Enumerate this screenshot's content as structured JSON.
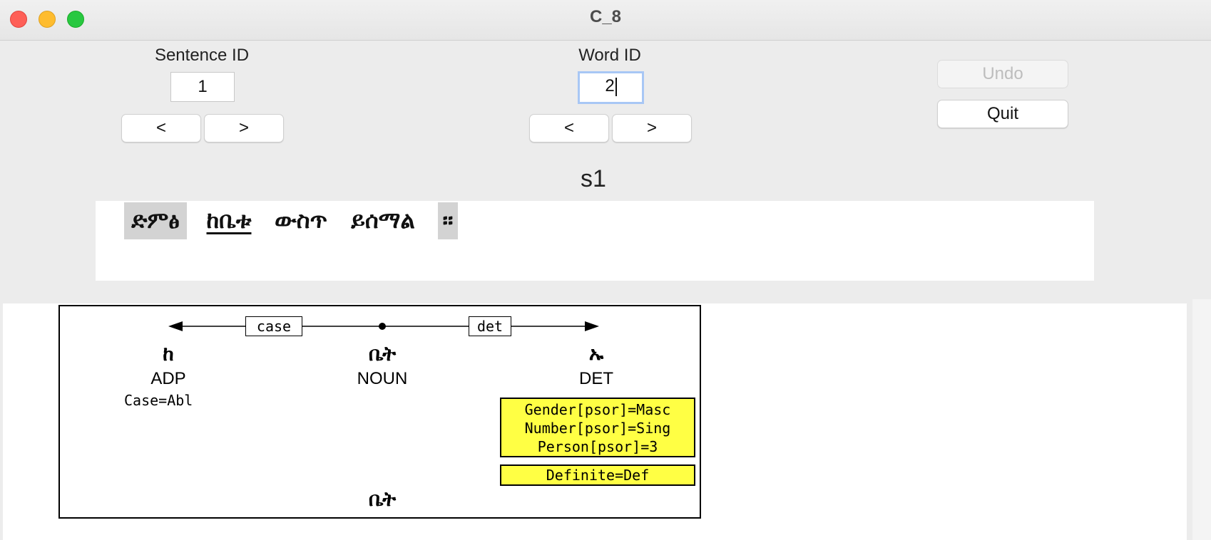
{
  "window": {
    "title": "C_8"
  },
  "controls": {
    "sentence_label": "Sentence ID",
    "sentence_value": "1",
    "word_label": "Word ID",
    "word_value": "2",
    "prev_label": "<",
    "next_label": ">",
    "undo_label": "Undo",
    "quit_label": "Quit"
  },
  "sentence": {
    "id_label": "s1",
    "words": [
      "ድምፅ",
      "ከቤቱ",
      "ውስጥ",
      "ይሰማል",
      "።"
    ]
  },
  "tree": {
    "arcs": [
      "case",
      "det"
    ],
    "nodes": [
      {
        "form": "ከ",
        "upos": "ADP",
        "feats": "Case=Abl"
      },
      {
        "form": "ቤት",
        "upos": "NOUN",
        "lemma": "ቤት"
      },
      {
        "form": "ኡ",
        "upos": "DET",
        "feats_box1": [
          "Gender[psor]=Masc",
          "Number[psor]=Sing",
          "Person[psor]=3"
        ],
        "feats_box2": "Definite=Def"
      }
    ]
  },
  "colors": {
    "feature_highlight": "#ffff44",
    "focus_ring": "#a8c7f5",
    "word_highlight": "#d3d3d3"
  }
}
